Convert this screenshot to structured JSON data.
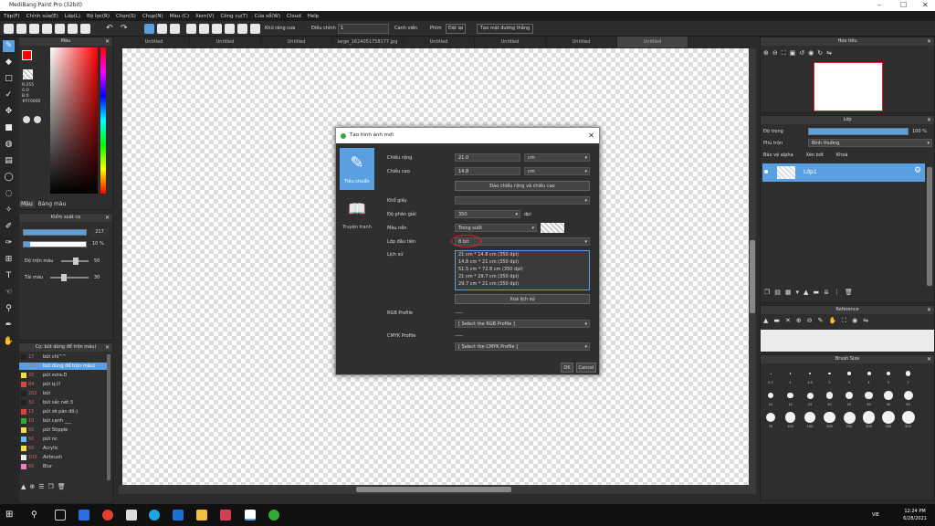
{
  "window": {
    "title": "MediBang Paint Pro (32bit)"
  },
  "menu": [
    "Tệp(F)",
    "Chỉnh sửa(E)",
    "Lớp(L)",
    "Bộ lọc(R)",
    "Chọn(S)",
    "Chụp(N)",
    "Màu (C)",
    "Xem(V)",
    "Công cụ(T)",
    "Cửa sổ(W)",
    "Cloud",
    "Help"
  ],
  "toolbar": {
    "antialias": "Khử răng cưa",
    "correction": "Điều chỉnh",
    "correction_value": "1",
    "edge": "Canh viền",
    "snap": "Phím",
    "snap_off": "Đặt lại",
    "straight": "Tạo mặt đường thẳng"
  },
  "tabs": [
    "Untitled",
    "Untitled",
    "Untitled",
    "large_1624051758177.jpg",
    "Untitled",
    "Untitled",
    "Untitled",
    "Untitled"
  ],
  "color_panel": {
    "title": "Màu",
    "r": "R:255",
    "g": "G:0",
    "b": "B:0",
    "hex": "#FF0000",
    "tab1": "Màu",
    "tab2": "Bảng màu"
  },
  "brush_control": {
    "title": "Kiểm soát cọ",
    "size": "217",
    "opacity": "10 %",
    "blend_label": "Độ trộn màu",
    "blend_value": "50",
    "load_label": "Tải màu",
    "load_value": "30"
  },
  "brush_list": {
    "title": "Cọ: bút dùng để trộn màu)",
    "items": [
      {
        "size": "17",
        "name": "bút chì^^",
        "color": "#222222"
      },
      {
        "size": "217",
        "name": "bút dùng để trộn màu)",
        "color": "#5aa0e0"
      },
      {
        "size": "20",
        "name": "pút sưra:D",
        "color": "#f0e040"
      },
      {
        "size": "84",
        "name": "pút q:)?",
        "color": "#e04040"
      },
      {
        "size": "202",
        "name": "bút",
        "color": "#222222"
      },
      {
        "size": "32",
        "name": "bút sắc nét:3",
        "color": "#222222"
      },
      {
        "size": "15",
        "name": "pút zẽ pàn đồ:)",
        "color": "#e04040"
      },
      {
        "size": "10",
        "name": "bút cạnh ___",
        "color": "#30b030"
      },
      {
        "size": "50",
        "name": "pút Stipple",
        "color": "#f0e040"
      },
      {
        "size": "50",
        "name": "pút nc",
        "color": "#60c0f0"
      },
      {
        "size": "50",
        "name": "Acrylic",
        "color": "#f0e040"
      },
      {
        "size": "100",
        "name": "Airbrush",
        "color": "#eeeeee"
      },
      {
        "size": "50",
        "name": "Blur",
        "color": "#f080c0"
      }
    ]
  },
  "dialog": {
    "title": "Tạo hình ảnh mới",
    "side1": "Tiêu chuẩn",
    "side2": "Truyện tranh",
    "width_label": "Chiều rộng",
    "width_value": "21.0",
    "width_unit": "cm",
    "height_label": "Chiều cao",
    "height_value": "14.8",
    "height_unit": "cm",
    "swap": "Đảo chiều rộng và chiều cao",
    "paper_label": "Khổ giấy",
    "dpi_label": "Độ phân giải",
    "dpi_value": "350",
    "dpi_unit": "dpi",
    "bg_label": "Màu nền",
    "bg_value": "Trong suốt",
    "mode_label": "Lớp đầu tiên",
    "mode_value": "8 bit",
    "history_label": "Lịch sử",
    "history": [
      "21 cm * 14.8 cm (350 dpi)",
      "14.8 cm * 21 cm (350 dpi)",
      "51.5 cm * 72.8 cm (350 dpi)",
      "21 cm * 29.7 cm (350 dpi)",
      "29.7 cm * 21 cm (350 dpi)"
    ],
    "clear_history": "Xoá lịch sử",
    "rgb_label": "RGB Profile",
    "rgb_dash": "-----",
    "rgb_select": "[ Select the RGB Profile ]",
    "cmyk_label": "CMYK Profile",
    "cmyk_dash": "-----",
    "cmyk_select": "[ Select the CMYK Profile ]",
    "ok": "OK",
    "cancel": "Cancel"
  },
  "navigator": {
    "title": "Hoa tiêu"
  },
  "layers": {
    "title": "Lớp",
    "opacity_label": "Độ trong",
    "opacity_value": "100 %",
    "blend_label": "Phù trộn",
    "blend_value": "Bình thường",
    "protect": "Bảo vệ alpha",
    "clip": "Xén bớt",
    "lock": "Khoá",
    "layer_name": "Lớp1",
    "opacity": 1.0
  },
  "reference": {
    "title": "Reference"
  },
  "brush_size": {
    "title": "Brush Size",
    "labels": [
      "0.7",
      "1",
      "1.5",
      "2",
      "3",
      "4",
      "5",
      "7",
      "10",
      "12",
      "15",
      "20",
      "25",
      "30",
      "40",
      "50",
      "70",
      "100",
      "150",
      "200",
      "250",
      "300",
      "400",
      "500"
    ]
  },
  "clock": {
    "time": "12:24 PM",
    "date": "6/28/2021",
    "lang": "VIE"
  }
}
